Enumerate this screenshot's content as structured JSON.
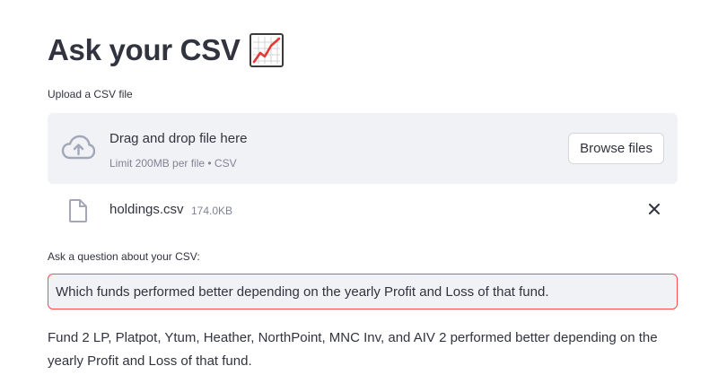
{
  "header": {
    "title": "Ask your CSV",
    "title_icon": "chart-increasing-emoji"
  },
  "uploader": {
    "label": "Upload a CSV file",
    "drop_text": "Drag and drop file here",
    "limit_text": "Limit 200MB per file • CSV",
    "browse_label": "Browse files",
    "icon": "cloud-upload-icon"
  },
  "uploaded_file": {
    "name": "holdings.csv",
    "size": "174.0KB",
    "icon": "file-icon",
    "remove_icon": "close-icon"
  },
  "question": {
    "label": "Ask a question about your CSV:",
    "value": "Which funds performed better depending on the yearly Profit and Loss of that fund."
  },
  "answer": {
    "text": "Fund 2 LP, Platpot, Ytum, Heather, NorthPoint, MNC Inv, and AIV 2 performed better depending on the yearly Profit and Loss of that fund."
  },
  "colors": {
    "accent": "#ff4b4b",
    "text": "#31333f",
    "muted": "#808495",
    "panel": "#f0f2f6"
  }
}
